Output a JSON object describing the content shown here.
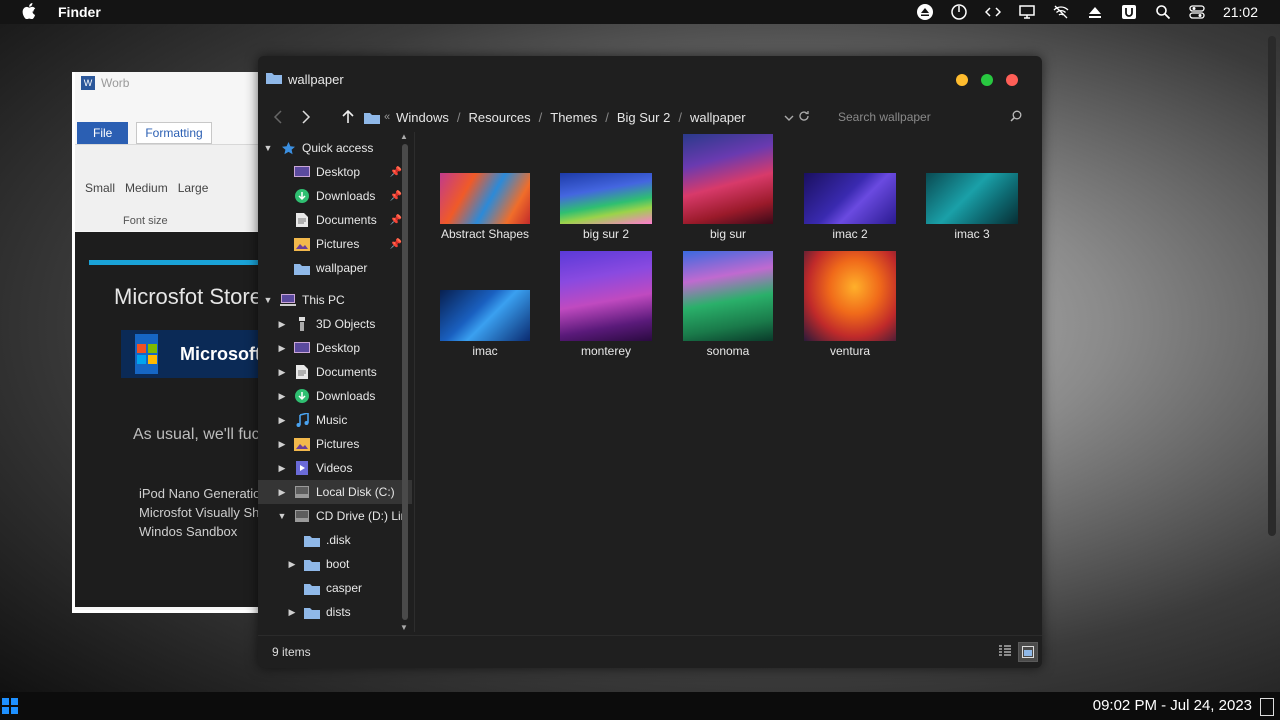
{
  "menubar": {
    "app_name": "Finder",
    "clock": "21:02"
  },
  "word": {
    "title": "Worb",
    "tab_file": "File",
    "tab_formatting": "Formatting",
    "font_sizes": [
      "Small",
      "Medium",
      "Large"
    ],
    "font_size_label": "Font size",
    "store_title": "Microsfot Store",
    "banner_text": "Microsoft",
    "paragraph": "As usual, we'll fuc",
    "list": [
      "iPod Nano Generatio",
      "Microsfot Visually Sh",
      "Windos Sandbox"
    ]
  },
  "explorer": {
    "title": "wallpaper",
    "breadcrumbs": [
      "Windows",
      "Resources",
      "Themes",
      "Big Sur 2",
      "wallpaper"
    ],
    "search_placeholder": "Search wallpaper",
    "status": "9 items",
    "sidebar": {
      "quick_access": "Quick access",
      "quick_items": [
        "Desktop",
        "Downloads",
        "Documents",
        "Pictures",
        "wallpaper"
      ],
      "this_pc": "This PC",
      "pc_items": [
        "3D Objects",
        "Desktop",
        "Documents",
        "Downloads",
        "Music",
        "Pictures",
        "Videos",
        "Local Disk (C:)",
        "CD Drive (D:) Lin"
      ],
      "cd_items": [
        ".disk",
        "boot",
        "casper",
        "dists"
      ]
    },
    "files": [
      "Abstract Shapes",
      "big sur 2",
      "big sur",
      "imac 2",
      "imac 3",
      "imac",
      "monterey",
      "sonoma",
      "ventura"
    ]
  },
  "taskbar": {
    "datetime": "09:02 PM - Jul 24, 2023"
  },
  "colors": {
    "accent_blue": "#1e90ff",
    "close": "#ff5f57",
    "minimize": "#febc2e",
    "maximize": "#28c840"
  }
}
